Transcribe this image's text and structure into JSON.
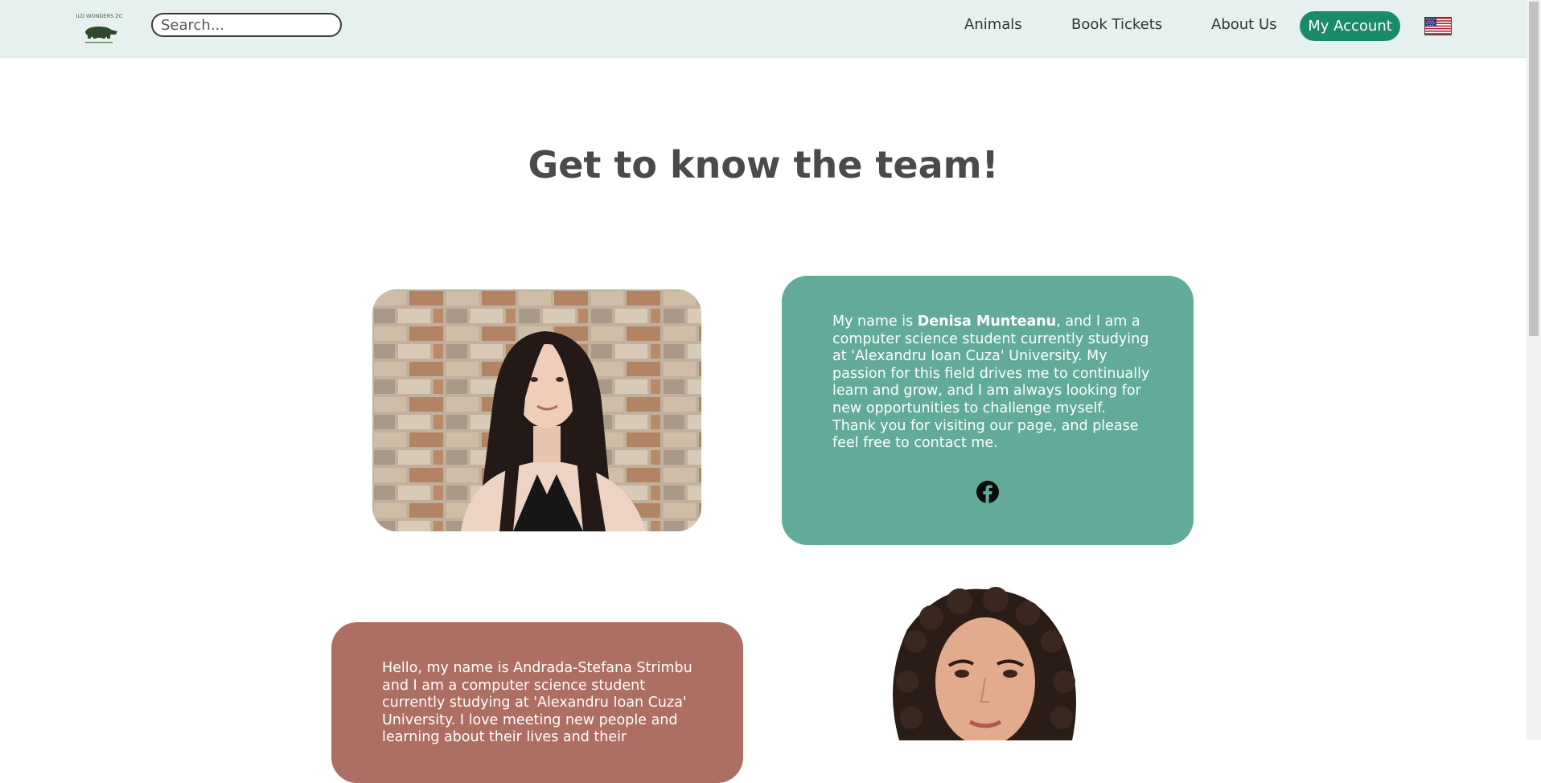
{
  "header": {
    "logo_alt": "WILD WONDERS ZOO",
    "search_placeholder": "Search...",
    "nav": {
      "animals": "Animals",
      "book_tickets": "Book Tickets",
      "about_us": "About Us"
    },
    "account_button": "My Account",
    "language_icon": "us-flag-icon"
  },
  "main": {
    "title": "Get to know the team!",
    "members": [
      {
        "text_before": "My name is ",
        "name": "Denisa Munteanu",
        "text_after": ", and I am a computer science student currently studying at 'Alexandru Ioan Cuza' University. My passion for this field drives me to continually learn and grow, and I am always looking for new opportunities to challenge myself. Thank you for visiting our page, and please feel free to contact me.",
        "social_icon": "facebook-icon",
        "card_color": "#62ab9a"
      },
      {
        "text": "Hello, my name is Andrada-Stefana Strimbu and I am a computer science student currently studying at 'Alexandru Ioan Cuza' University. I love meeting new people and learning about their lives and their",
        "card_color": "#ad6e63"
      }
    ]
  },
  "colors": {
    "header_bg": "#e6f0ee",
    "accent": "#1b8a6b",
    "card_green": "#62ab9a",
    "card_red": "#ad6e63"
  }
}
